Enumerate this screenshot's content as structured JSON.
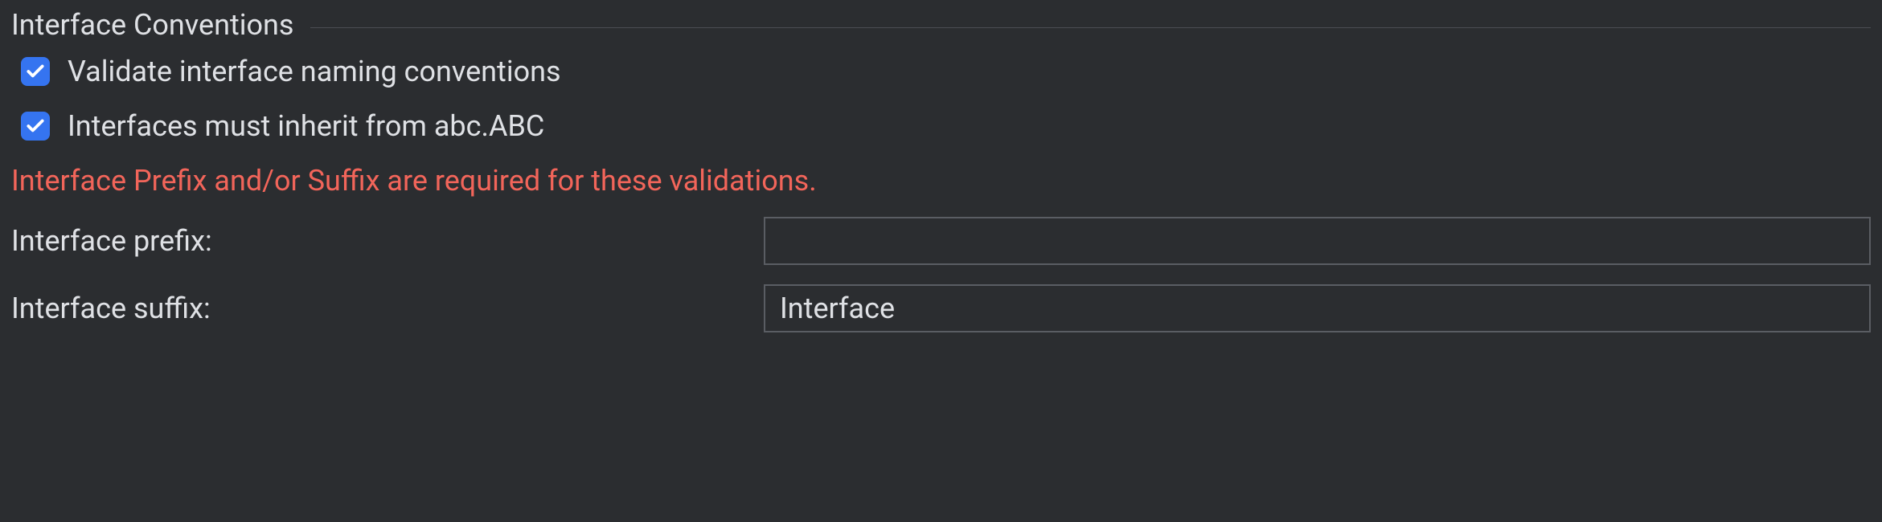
{
  "section": {
    "title": "Interface Conventions"
  },
  "checkboxes": {
    "validate_naming": {
      "label": "Validate interface naming conventions",
      "checked": true
    },
    "inherit_abc": {
      "label": "Interfaces must inherit from abc.ABC",
      "checked": true
    }
  },
  "error": {
    "message": "Interface Prefix and/or Suffix are required for these validations."
  },
  "fields": {
    "prefix": {
      "label": "Interface prefix:",
      "value": ""
    },
    "suffix": {
      "label": "Interface suffix:",
      "value": "Interface"
    }
  }
}
